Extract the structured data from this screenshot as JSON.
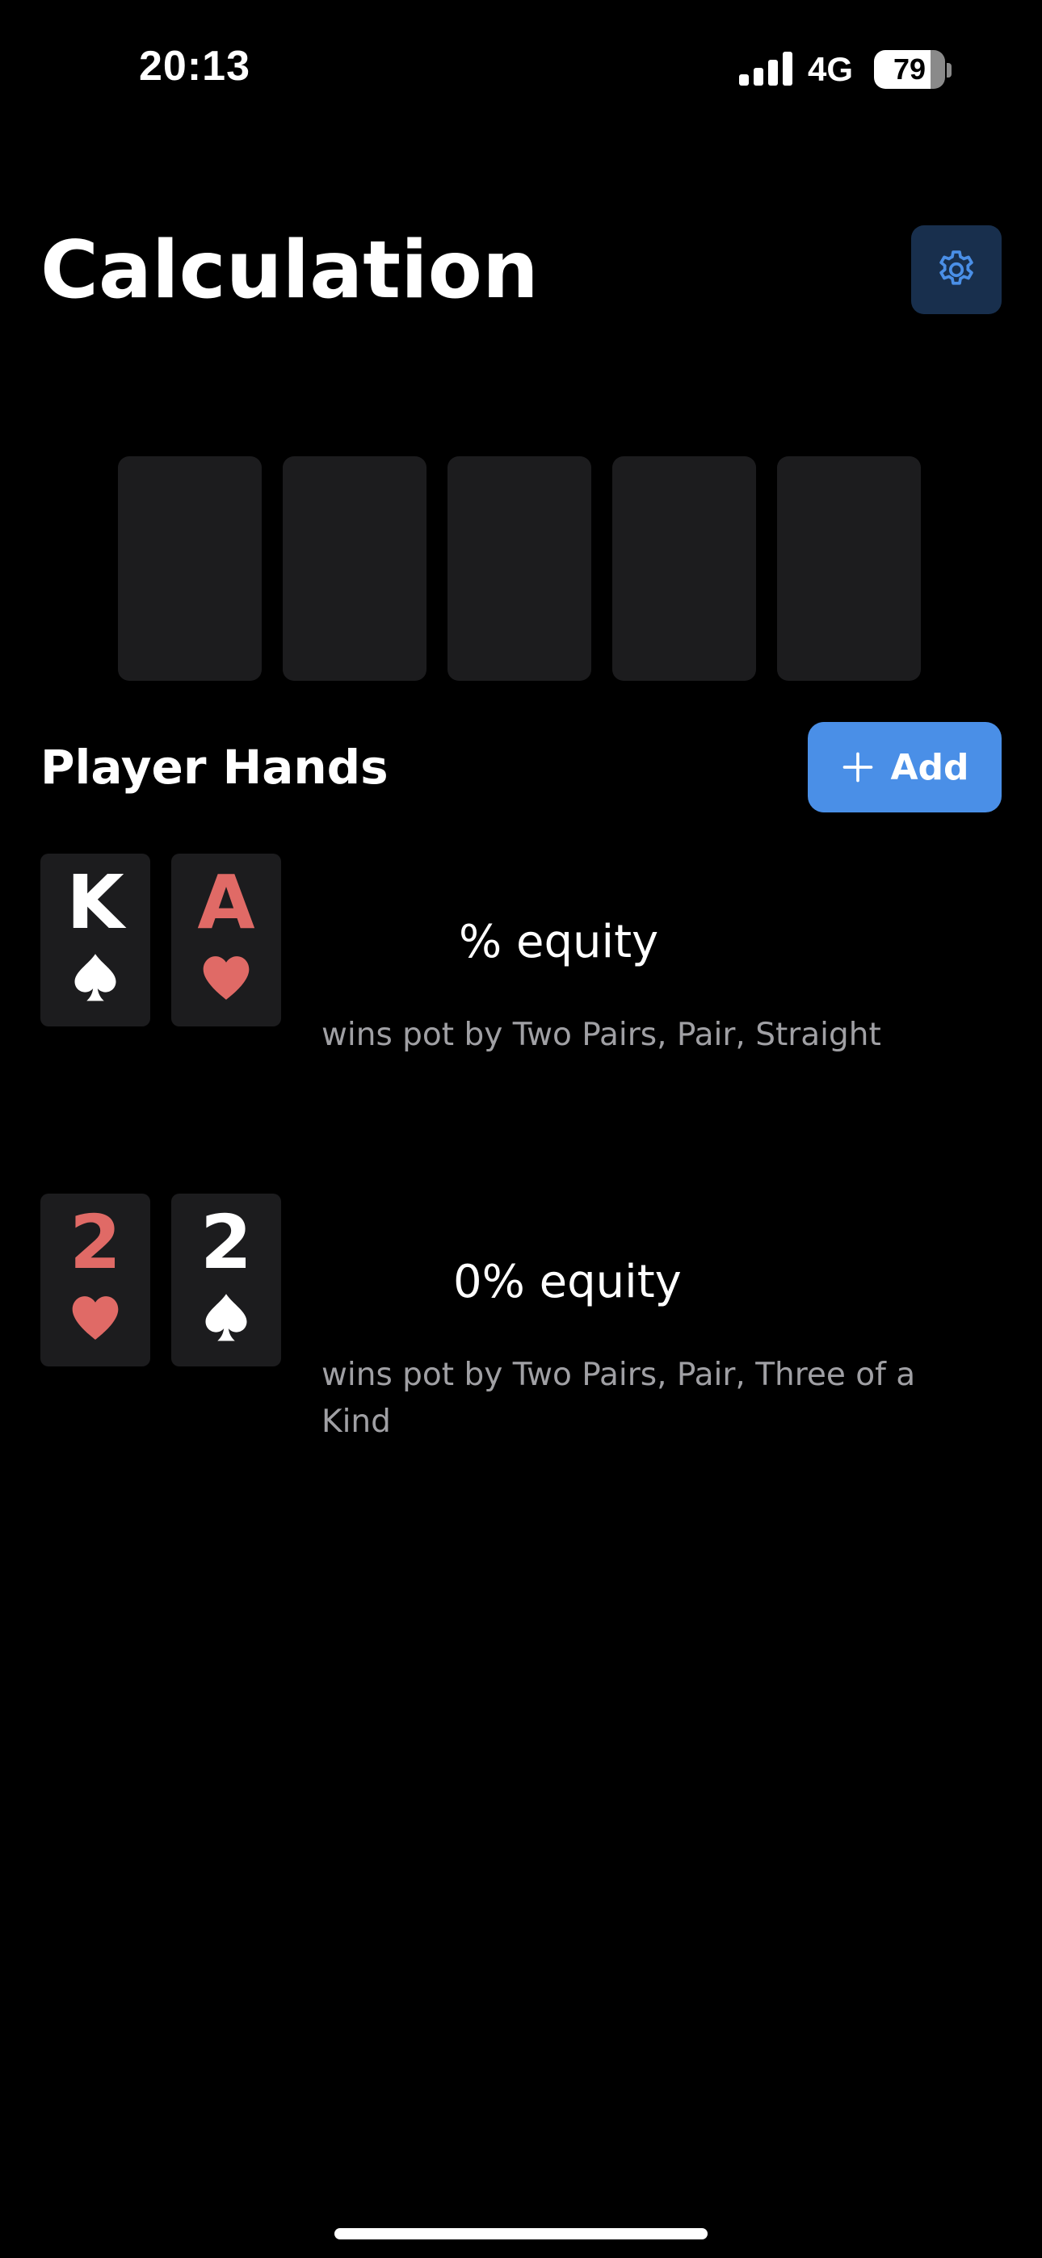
{
  "status_bar": {
    "time": "20:13",
    "network": "4G",
    "battery_percent": "79",
    "battery_level": 0.79
  },
  "header": {
    "title": "Calculation",
    "settings_icon": "gear-icon"
  },
  "board": {
    "slots": 5
  },
  "player_hands": {
    "title": "Player Hands",
    "add_label": "Add",
    "add_icon": "plus-icon",
    "hands": [
      {
        "cards": [
          {
            "rank": "K",
            "suit": "spade"
          },
          {
            "rank": "A",
            "suit": "heart"
          }
        ],
        "equity_visible": "% equity",
        "wins_text": "wins pot by Two Pairs, Pair, Straight"
      },
      {
        "cards": [
          {
            "rank": "2",
            "suit": "heart"
          },
          {
            "rank": "2",
            "suit": "spade"
          }
        ],
        "equity_visible": "0% equity",
        "wins_text": "wins pot by Two Pairs, Pair, Three of a Kind"
      }
    ]
  },
  "colors": {
    "background": "#000000",
    "card_bg": "#1c1c1e",
    "accent": "#4a8fe7",
    "settings_bg": "#182f4d",
    "red_suit": "#e06a66",
    "secondary_text": "#a0a0a4"
  }
}
